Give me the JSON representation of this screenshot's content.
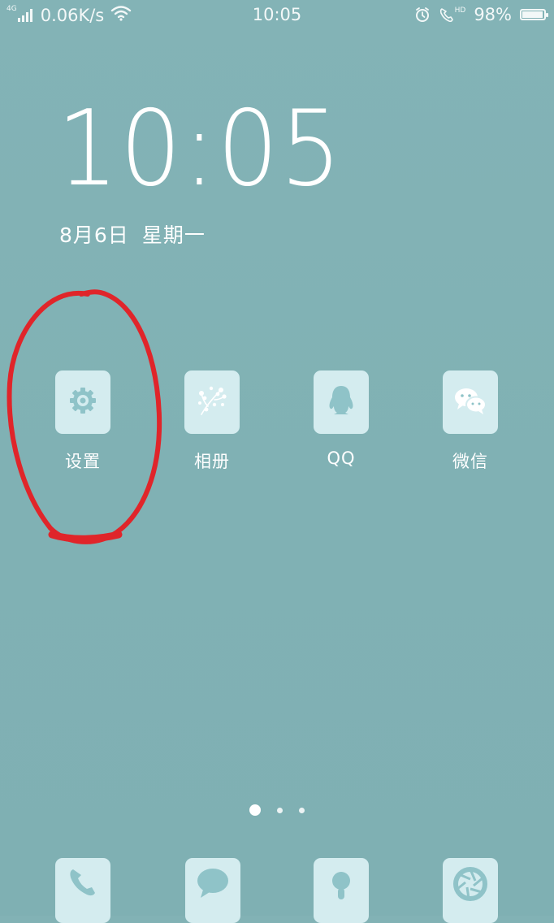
{
  "status_bar": {
    "network_type": "4G",
    "net_speed": "0.06K/s",
    "time": "10:05",
    "battery_text": "98%",
    "battery_level": 0.98,
    "call_badge": "HD"
  },
  "clock": {
    "time": "10:05",
    "date": "8月6日",
    "weekday": "星期一"
  },
  "apps": [
    {
      "label": "设置",
      "icon": "gear-icon"
    },
    {
      "label": "相册",
      "icon": "gallery-icon"
    },
    {
      "label": "QQ",
      "icon": "qq-penguin-icon"
    },
    {
      "label": "微信",
      "icon": "wechat-icon"
    }
  ],
  "pager": {
    "pages": 3,
    "current": 1
  },
  "dock": [
    {
      "icon": "phone-icon"
    },
    {
      "icon": "messages-icon"
    },
    {
      "icon": "browser-icon"
    },
    {
      "icon": "camera-icon"
    }
  ],
  "colors": {
    "wallpaper": "#82b2b5",
    "tile": "#d4ecef",
    "glyph": "#8fc3c8",
    "annotation": "#e0252a"
  }
}
